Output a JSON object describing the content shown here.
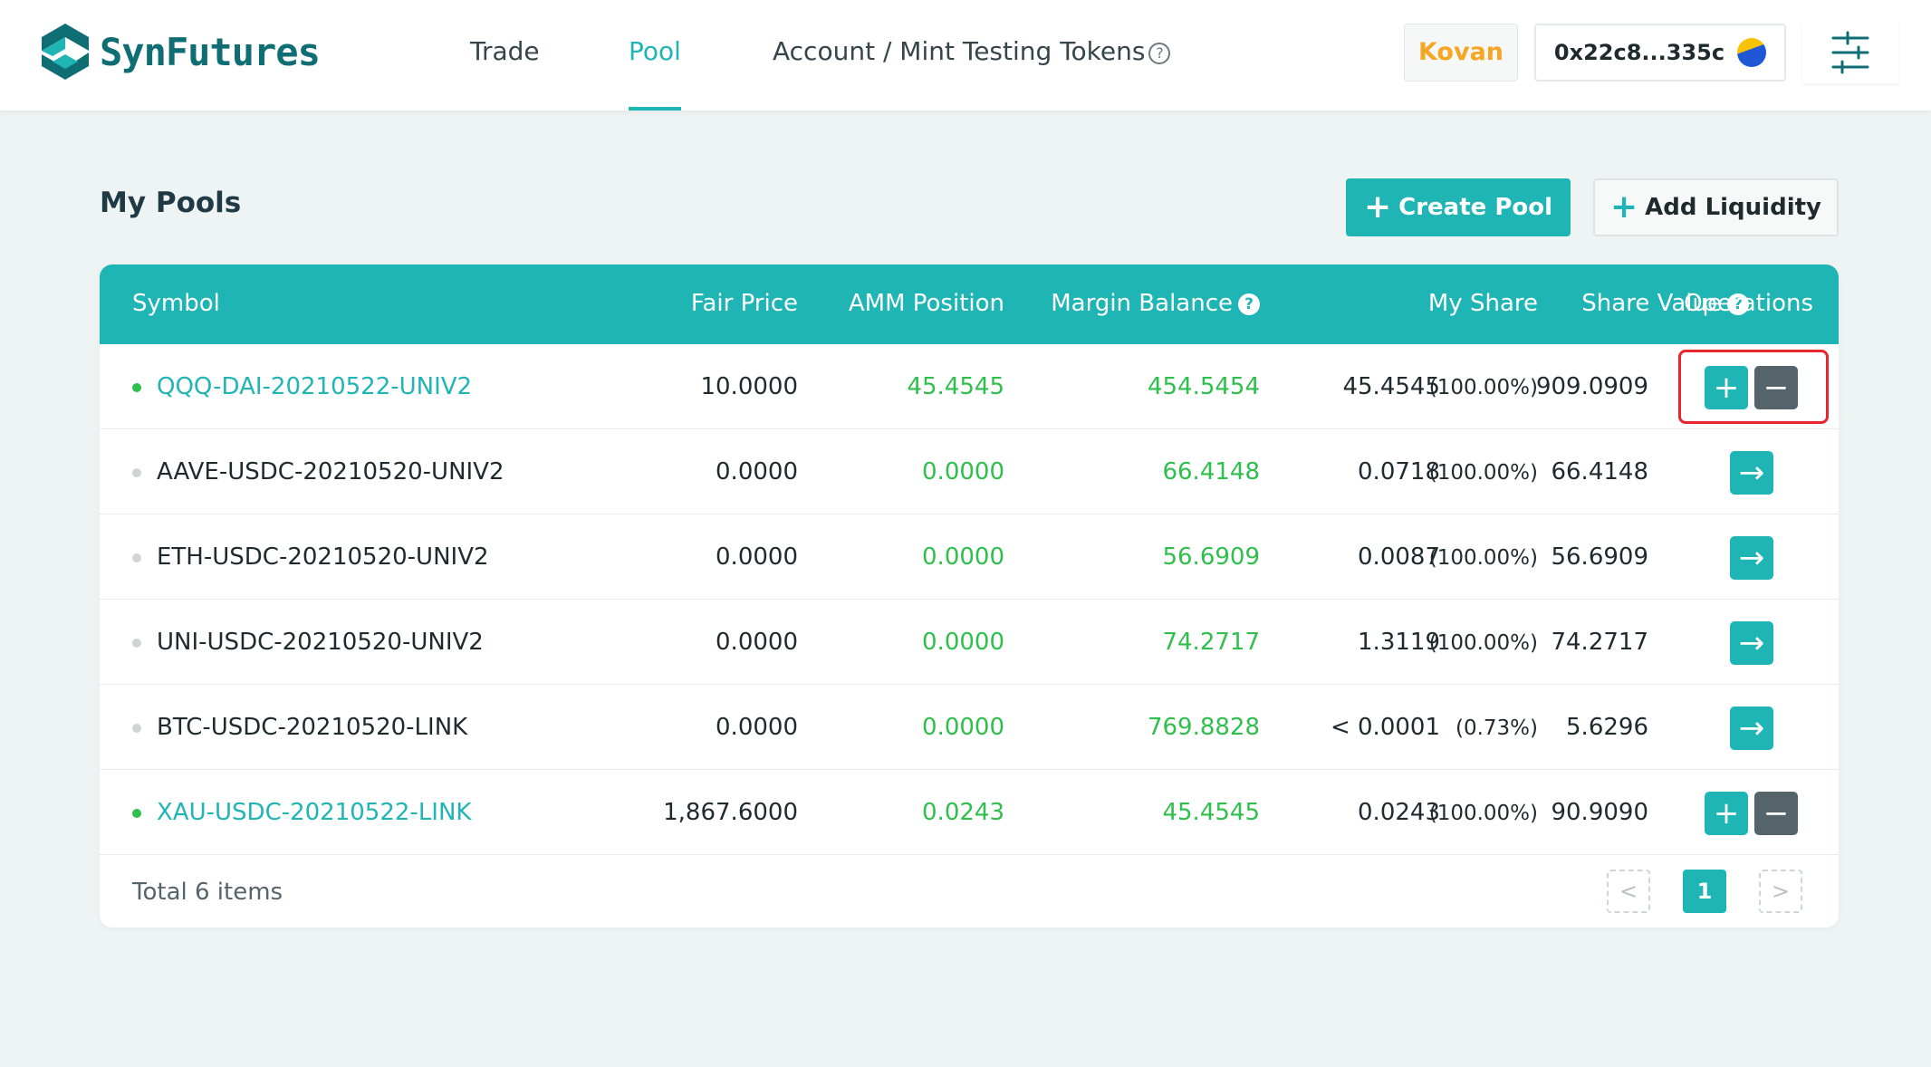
{
  "header": {
    "brand": "SynFutures",
    "nav": [
      {
        "label": "Trade"
      },
      {
        "label": "Pool"
      },
      {
        "label": "Account / Mint Testing Tokens"
      }
    ],
    "network": "Kovan",
    "wallet_address": "0x22c8...335c"
  },
  "page": {
    "title": "My Pools",
    "create_pool_label": "Create Pool",
    "add_liquidity_label": "Add Liquidity"
  },
  "table": {
    "columns": {
      "symbol": "Symbol",
      "fair_price": "Fair Price",
      "amm_position": "AMM Position",
      "margin_balance": "Margin Balance",
      "my_share": "My Share",
      "share_value": "Share Value",
      "operations": "Operations"
    },
    "rows": [
      {
        "symbol": "QQQ-DAI-20210522-UNIV2",
        "active": true,
        "fair_price": "10.0000",
        "amm_position": "45.4545",
        "margin_balance": "454.5454",
        "my_share": "45.4545",
        "share_pct": "(100.00%)",
        "share_value": "909.0909",
        "ops": "plus-minus"
      },
      {
        "symbol": "AAVE-USDC-20210520-UNIV2",
        "active": false,
        "fair_price": "0.0000",
        "amm_position": "0.0000",
        "margin_balance": "66.4148",
        "my_share": "0.0718",
        "share_pct": "(100.00%)",
        "share_value": "66.4148",
        "ops": "arrow"
      },
      {
        "symbol": "ETH-USDC-20210520-UNIV2",
        "active": false,
        "fair_price": "0.0000",
        "amm_position": "0.0000",
        "margin_balance": "56.6909",
        "my_share": "0.0087",
        "share_pct": "(100.00%)",
        "share_value": "56.6909",
        "ops": "arrow"
      },
      {
        "symbol": "UNI-USDC-20210520-UNIV2",
        "active": false,
        "fair_price": "0.0000",
        "amm_position": "0.0000",
        "margin_balance": "74.2717",
        "my_share": "1.3119",
        "share_pct": "(100.00%)",
        "share_value": "74.2717",
        "ops": "arrow"
      },
      {
        "symbol": "BTC-USDC-20210520-LINK",
        "active": false,
        "fair_price": "0.0000",
        "amm_position": "0.0000",
        "margin_balance": "769.8828",
        "my_share": "< 0.0001",
        "share_pct": "(0.73%)",
        "share_value": "5.6296",
        "ops": "arrow"
      },
      {
        "symbol": "XAU-USDC-20210522-LINK",
        "active": true,
        "fair_price": "1,867.6000",
        "amm_position": "0.0243",
        "margin_balance": "45.4545",
        "my_share": "0.0243",
        "share_pct": "(100.00%)",
        "share_value": "90.9090",
        "ops": "plus-minus"
      }
    ],
    "total_label": "Total 6 items",
    "current_page": "1"
  },
  "colors": {
    "accent": "#20b5b5",
    "positive": "#2fbf4c",
    "network": "#f5a623",
    "highlight": "#e8262b"
  }
}
